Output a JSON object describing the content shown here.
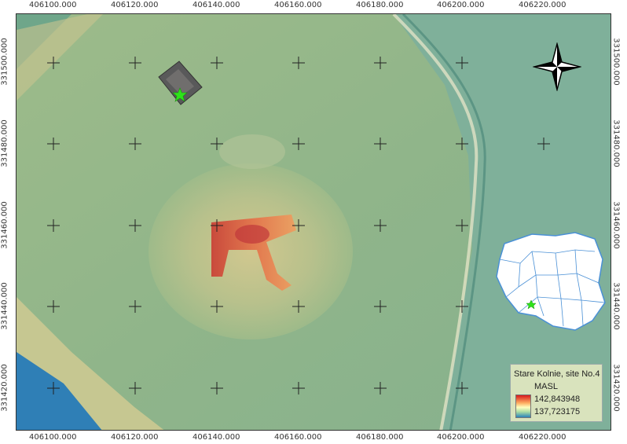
{
  "coordinates": {
    "x_labels": [
      "406100.000",
      "406120.000",
      "406140.000",
      "406160.000",
      "406180.000",
      "406200.000",
      "406220.000"
    ],
    "y_labels": [
      "331500.000",
      "331480.000",
      "331460.000",
      "331440.000",
      "331420.000"
    ]
  },
  "legend": {
    "title": "Stare Kolnie, site No.4",
    "unit": "MASL",
    "max_value": "142,843948",
    "min_value": "137,723175"
  },
  "colors": {
    "ramp_high": "#d7191c",
    "ramp_mid": "#ffffbf",
    "ramp_low": "#2b83ba",
    "terrain_base": "#8fb58a",
    "site_marker": "#2ee21a"
  },
  "icons": {
    "north_arrow": "north-arrow-icon",
    "site_marker": "star-marker-icon",
    "inset_map": "poland-map-icon"
  }
}
